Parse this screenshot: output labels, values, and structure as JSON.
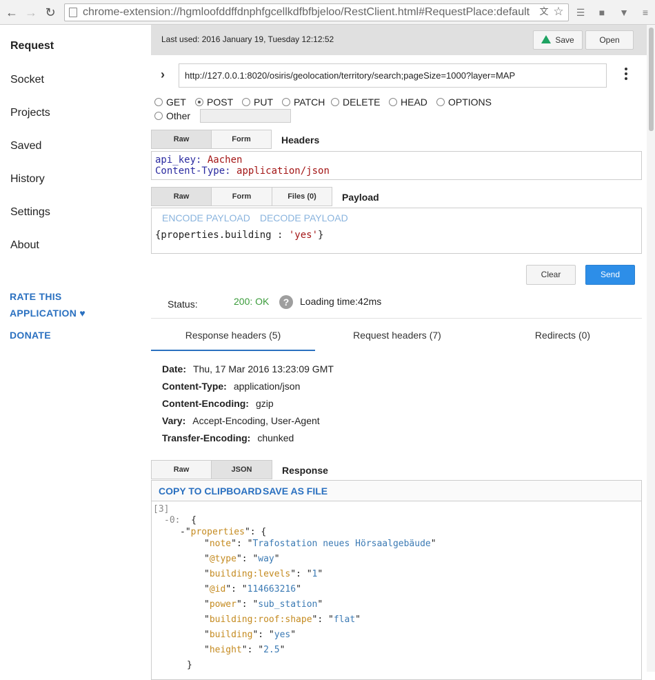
{
  "browser": {
    "url": "chrome-extension://hgmloofddffdnphfgcellkdfbfbjeloo/RestClient.html#RequestPlace:default"
  },
  "sidebar": {
    "items": [
      {
        "label": "Request",
        "active": true
      },
      {
        "label": "Socket"
      },
      {
        "label": "Projects"
      },
      {
        "label": "Saved"
      },
      {
        "label": "History"
      },
      {
        "label": "Settings"
      },
      {
        "label": "About"
      }
    ],
    "rate_line1": "RATE THIS",
    "rate_line2": "APPLICATION ♥",
    "donate": "DONATE"
  },
  "toolbar": {
    "last_used": "Last used: 2016 January 19, Tuesday 12:12:52",
    "save_label": "Save",
    "open_label": "Open"
  },
  "request": {
    "url": "http://127.0.0.1:8020/osiris/geolocation/territory/search;pageSize=1000?layer=MAP",
    "methods": [
      "GET",
      "POST",
      "PUT",
      "PATCH",
      "DELETE",
      "HEAD",
      "OPTIONS"
    ],
    "selected_method": "POST",
    "other_label": "Other",
    "headers_tabs": {
      "raw": "Raw",
      "form": "Form"
    },
    "headers_label": "Headers",
    "headers": [
      {
        "key": "api_key",
        "value": "Aachen"
      },
      {
        "key": "Content-Type",
        "value": "application/json"
      }
    ],
    "payload_tabs": {
      "raw": "Raw",
      "form": "Form",
      "files": "Files (0)"
    },
    "payload_label": "Payload",
    "encode": "ENCODE PAYLOAD",
    "decode": "DECODE PAYLOAD",
    "payload_prefix": "{properties.building : ",
    "payload_value": "'yes'",
    "payload_suffix": "}",
    "clear_label": "Clear",
    "send_label": "Send"
  },
  "response": {
    "status_label": "Status:",
    "status_code": "200: OK",
    "help": "?",
    "loading": "Loading time:42ms",
    "tabs": [
      "Response headers (5)",
      "Request headers (7)",
      "Redirects (0)"
    ],
    "headers": [
      {
        "key": "Date:",
        "value": "Thu, 17 Mar 2016 13:23:09 GMT"
      },
      {
        "key": "Content-Type:",
        "value": "application/json"
      },
      {
        "key": "Content-Encoding:",
        "value": "gzip"
      },
      {
        "key": "Vary:",
        "value": "Accept-Encoding, User-Agent"
      },
      {
        "key": "Transfer-Encoding:",
        "value": "chunked"
      }
    ],
    "body_tabs": {
      "raw": "Raw",
      "json": "JSON"
    },
    "body_label": "Response",
    "copy": "COPY TO CLIPBOARD",
    "save_file": "SAVE AS FILE",
    "json": {
      "count": "[3]",
      "index": "-0:",
      "open_brace": "{",
      "properties_key": "properties",
      "properties": [
        {
          "key": "note",
          "value": "Trafostation neues Hörsaalgebäude"
        },
        {
          "key": "@type",
          "value": "way"
        },
        {
          "key": "building:levels",
          "value": "1"
        },
        {
          "key": "@id",
          "value": "114663216"
        },
        {
          "key": "power",
          "value": "sub_station"
        },
        {
          "key": "building:roof:shape",
          "value": "flat"
        },
        {
          "key": "building",
          "value": "yes"
        },
        {
          "key": "height",
          "value": "2.5"
        }
      ],
      "close_brace": "}"
    }
  }
}
